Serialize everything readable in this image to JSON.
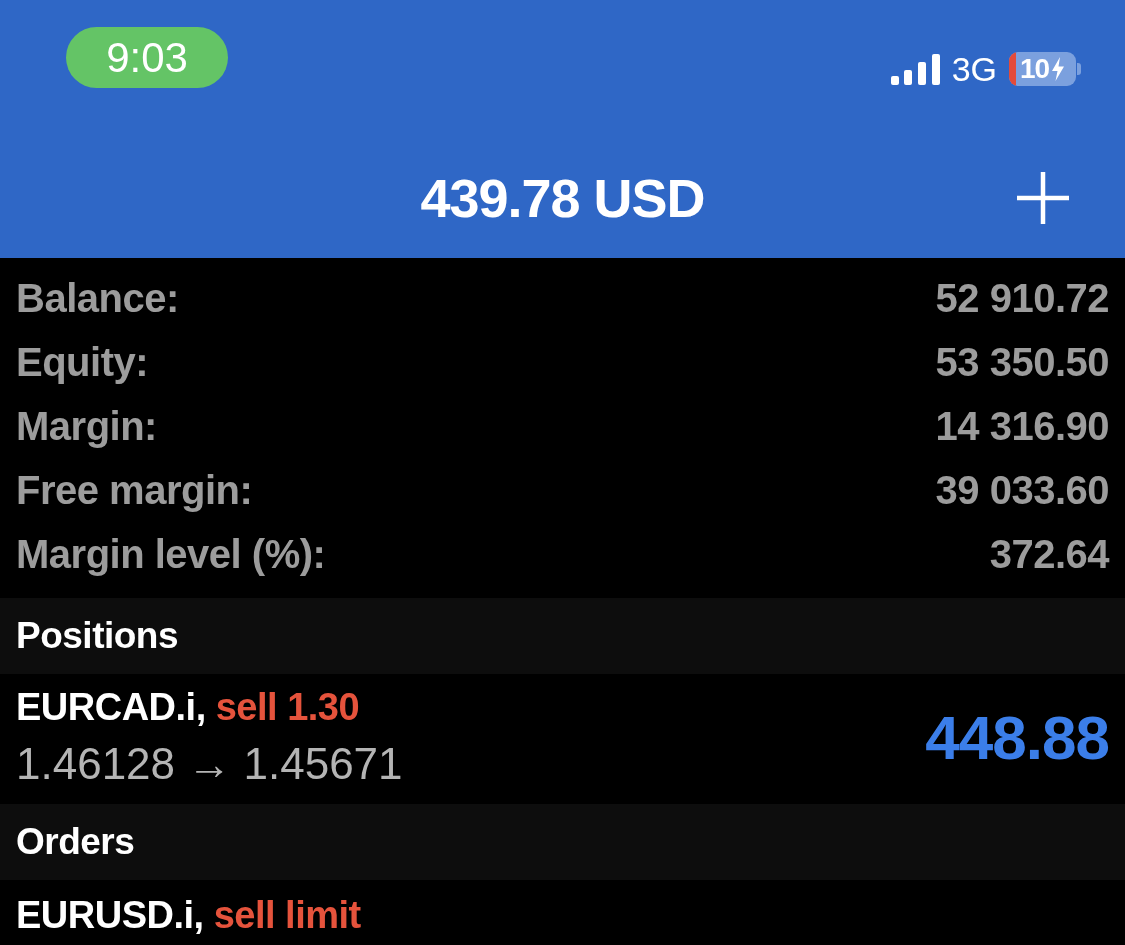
{
  "status_bar": {
    "time": "9:03",
    "network": "3G",
    "battery": "10",
    "charging": true
  },
  "header": {
    "title": "439.78 USD"
  },
  "account": [
    {
      "label": "Balance:",
      "value": "52 910.72"
    },
    {
      "label": "Equity:",
      "value": "53 350.50"
    },
    {
      "label": "Margin:",
      "value": "14 316.90"
    },
    {
      "label": "Free margin:",
      "value": "39 033.60"
    },
    {
      "label": "Margin level (%):",
      "value": "372.64"
    }
  ],
  "sections": [
    {
      "title": "Positions",
      "items": [
        {
          "symbol": "EURCAD.i,",
          "sell": true,
          "type": "sell 1.30",
          "prices": "1.46128 → 1.45671",
          "profit": "448.88"
        }
      ]
    },
    {
      "title": "Orders",
      "items": [
        {
          "symbol": "EURUSD.i,",
          "sell": true,
          "type": "sell limit"
        }
      ]
    }
  ]
}
